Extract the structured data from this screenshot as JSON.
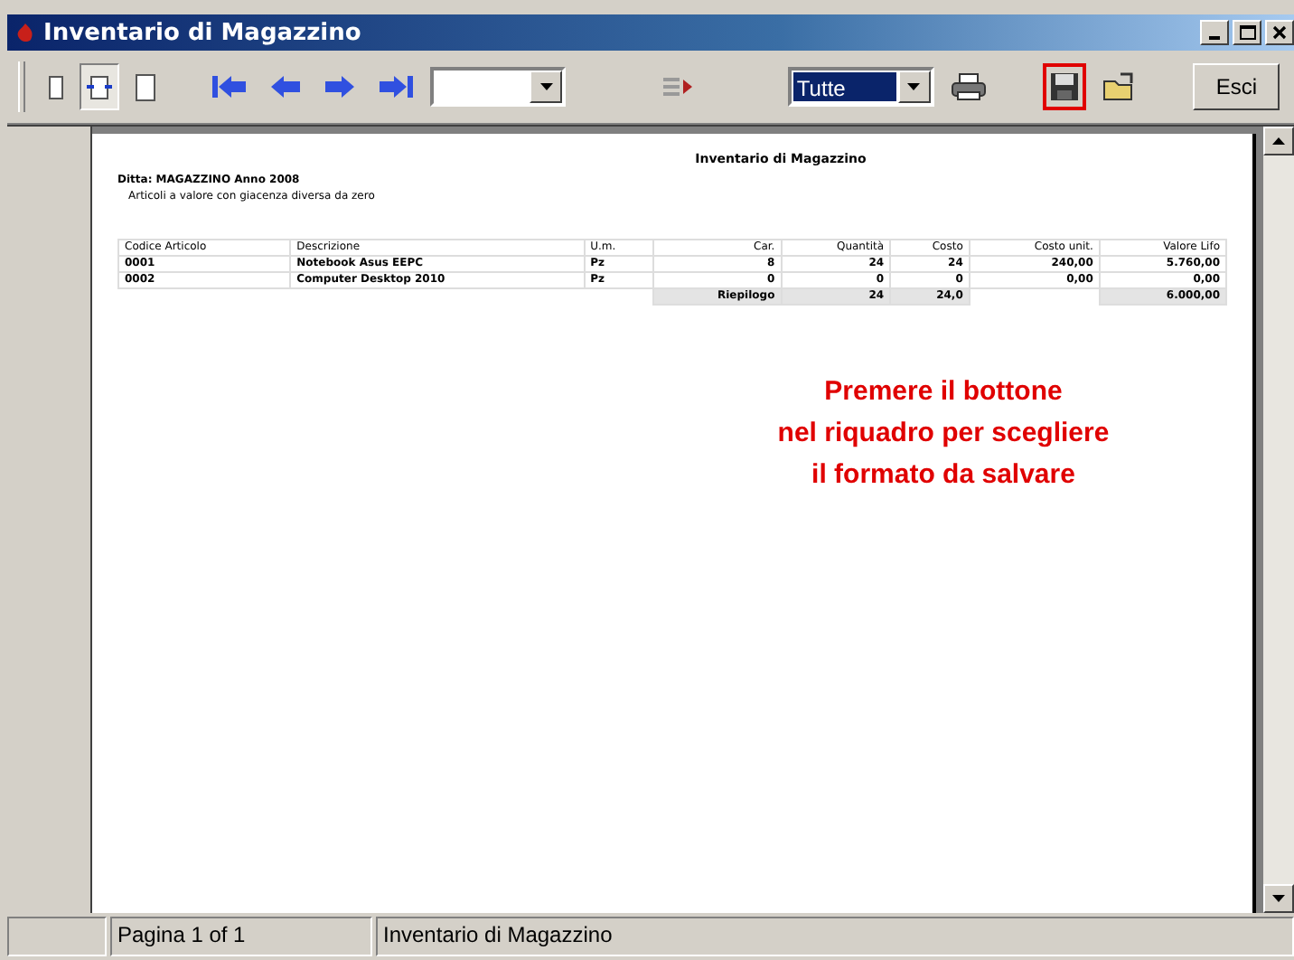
{
  "window": {
    "title": "Inventario di Magazzino"
  },
  "toolbar": {
    "filter": {
      "value": "Tutte"
    },
    "save_highlighted": true,
    "exit_button": "Esci"
  },
  "report": {
    "title": "Inventario di Magazzino",
    "subtitle": "Ditta: MAGAZZINO Anno 2008",
    "note": "Articoli a valore con giacenza diversa da zero",
    "columns": [
      "Codice Articolo",
      "Descrizione",
      "U.m.",
      "Car.",
      "Quantità",
      "Costo",
      "Costo unit.",
      "Valore Lifo"
    ],
    "rows": [
      [
        "0001",
        "Notebook Asus EEPC",
        "Pz",
        "8",
        "24",
        "24",
        "240,00",
        "5.760,00"
      ],
      [
        "0002",
        "Computer Desktop 2010",
        "Pz",
        "0",
        "0",
        "0",
        "0,00",
        "0,00"
      ]
    ],
    "totals": {
      "label": "Riepilogo",
      "quantity": "24",
      "cost": "24,0",
      "value": "6.000,00"
    }
  },
  "callout": "Premere il bottone\nnel riquadro per scegliere\nil formato da salvare",
  "status_bar": {
    "page": "Pagina 1 of 1",
    "report": "Inventario di Magazzino"
  }
}
